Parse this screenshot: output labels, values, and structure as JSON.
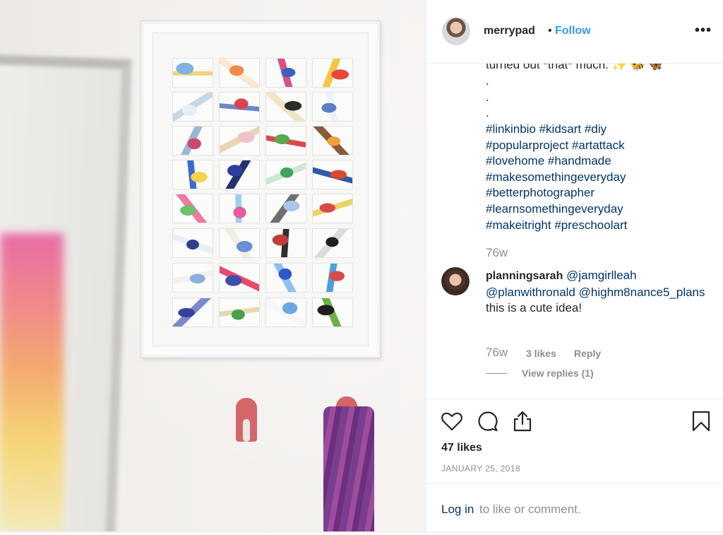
{
  "post": {
    "username": "merrypad",
    "separator": "•",
    "follow_label": "Follow",
    "more_label": "•••"
  },
  "caption": {
    "cut_line": "turned out *that* much. ✨ 🐝 🦋",
    "dots": [
      ".",
      ".",
      "."
    ],
    "hashtags": [
      "#linkinbio #kidsart #diy",
      "#popularproject #artattack",
      "#lovehome #handmade",
      "#makesomethingeveryday",
      "#betterphotographer",
      "#learnsomethingeveryday",
      "#makeitright #preschoolart"
    ],
    "time": "76w"
  },
  "comment": {
    "username": "planningsarah",
    "mention1": "@jamgirlleah",
    "mention2": "@planwithronald",
    "mention3": "@highm8nance5_plans",
    "text": "this is a cute idea!",
    "time": "76w",
    "likes": "3 likes",
    "reply_label": "Reply",
    "view_replies": "View replies (1)"
  },
  "actions": {
    "like_icon": "heart-icon",
    "comment_icon": "comment-icon",
    "share_icon": "share-icon",
    "save_icon": "bookmark-icon"
  },
  "likes_count": "47 likes",
  "date": "JANUARY 25, 2018",
  "login": {
    "link": "Log in",
    "rest": "to like or comment."
  },
  "colors": {
    "follow": "#3897f0",
    "link": "#003569",
    "muted": "#8e8e8e"
  }
}
